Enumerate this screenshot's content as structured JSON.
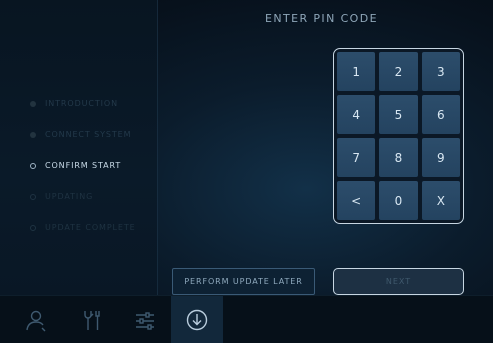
{
  "header": {
    "title": "ENTER PIN CODE"
  },
  "steps": [
    {
      "label": "INTRODUCTION",
      "state": "done"
    },
    {
      "label": "CONNECT SYSTEM",
      "state": "done"
    },
    {
      "label": "CONFIRM START",
      "state": "current"
    },
    {
      "label": "UPDATING",
      "state": "pending"
    },
    {
      "label": "UPDATE COMPLETE",
      "state": "pending"
    }
  ],
  "keypad": {
    "keys": [
      "1",
      "2",
      "3",
      "4",
      "5",
      "6",
      "7",
      "8",
      "9",
      "<",
      "0",
      "X"
    ]
  },
  "actions": {
    "later_label": "PERFORM UPDATE LATER",
    "next_label": "NEXT"
  },
  "nav": [
    {
      "icon": "person-icon"
    },
    {
      "icon": "tools-icon"
    },
    {
      "icon": "sliders-icon"
    },
    {
      "icon": "download-icon",
      "active": true
    }
  ],
  "colors": {
    "accent_border": "#c7d6e2",
    "key_fill": "#2c4d6b",
    "active_tab": "#12283b"
  }
}
